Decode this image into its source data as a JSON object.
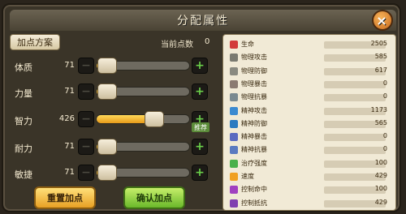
{
  "title": "分配属性",
  "close_label": "×",
  "scheme_tab": "加点方案",
  "points_label": "当前点数",
  "points_value": "0",
  "attributes": [
    {
      "name": "体质",
      "value": "71",
      "fill": 0.12
    },
    {
      "name": "力量",
      "value": "71",
      "fill": 0.12
    },
    {
      "name": "智力",
      "value": "426",
      "fill": 0.62,
      "recommend": "推荐"
    },
    {
      "name": "耐力",
      "value": "71",
      "fill": 0.12
    },
    {
      "name": "敏捷",
      "value": "71",
      "fill": 0.12
    }
  ],
  "reset_label": "重置加点",
  "confirm_label": "确认加点",
  "stats": [
    {
      "name": "生命",
      "value": "2505",
      "color": "#d23a3a"
    },
    {
      "name": "物理攻击",
      "value": "585",
      "color": "#7a7a70"
    },
    {
      "name": "物理防御",
      "value": "617",
      "color": "#8a8a80"
    },
    {
      "name": "物理暴击",
      "value": "0",
      "color": "#8a7a70"
    },
    {
      "name": "物理抗暴",
      "value": "0",
      "color": "#7a8a90"
    },
    {
      "name": "精神攻击",
      "value": "1173",
      "color": "#3a8ad0"
    },
    {
      "name": "精神防御",
      "value": "565",
      "color": "#2a7ac0"
    },
    {
      "name": "精神暴击",
      "value": "0",
      "color": "#5a6ac0"
    },
    {
      "name": "精神抗暴",
      "value": "0",
      "color": "#5a7ac0"
    },
    {
      "name": "治疗强度",
      "value": "100",
      "color": "#4ab04a"
    },
    {
      "name": "速度",
      "value": "429",
      "color": "#f0a020"
    },
    {
      "name": "控制命中",
      "value": "100",
      "color": "#a040c0"
    },
    {
      "name": "控制抵抗",
      "value": "429",
      "color": "#8040b0"
    }
  ]
}
